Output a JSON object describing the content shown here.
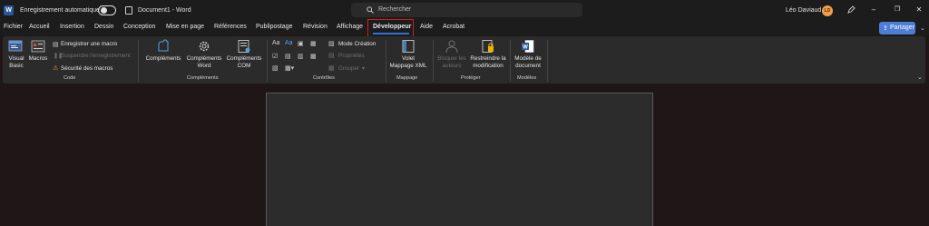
{
  "titlebar": {
    "autosave_label": "Enregistrement automatique",
    "doc_title": "Document1  -  Word",
    "search_placeholder": "Rechercher",
    "user_name": "Léo Daviaud",
    "avatar_initials": "LD"
  },
  "menu": {
    "tabs": [
      "Fichier",
      "Accueil",
      "Insertion",
      "Dessin",
      "Conception",
      "Mise en page",
      "Références",
      "Publipostage",
      "Révision",
      "Affichage",
      "Développeur",
      "Aide",
      "Acrobat"
    ],
    "active_tab": "Développeur",
    "share_label": "Partager"
  },
  "ribbon": {
    "code": {
      "group_label": "Code",
      "visual_basic": [
        "Visual",
        "Basic"
      ],
      "macros": "Macros",
      "record_macro": "Enregistrer une macro",
      "pause_recording": "Suspendre l'enregistrement",
      "macro_security": "Sécurité des macros"
    },
    "complements": {
      "group_label": "Compléments",
      "complements": "Compléments",
      "word_complements": [
        "Compléments",
        "Word"
      ],
      "com_complements": [
        "Compléments",
        "COM"
      ]
    },
    "controles": {
      "group_label": "Contrôles",
      "design_mode": "Mode Création",
      "properties": "Propriétés",
      "group": "Grouper"
    },
    "mappage": {
      "group_label": "Mappage",
      "xml_pane": [
        "Volet",
        "Mappage XML"
      ]
    },
    "proteger": {
      "group_label": "Protéger",
      "block_authors": [
        "Bloquer les",
        "auteurs"
      ],
      "restrict_editing": [
        "Restreindre la",
        "modification"
      ]
    },
    "modeles": {
      "group_label": "Modèles",
      "doc_template": [
        "Modèle de",
        "document"
      ]
    }
  },
  "colors": {
    "accent": "#2f6fd6",
    "highlight_box": "#d21c1c",
    "share_button": "#4d7dd6",
    "word_brand": "#2b579a"
  }
}
